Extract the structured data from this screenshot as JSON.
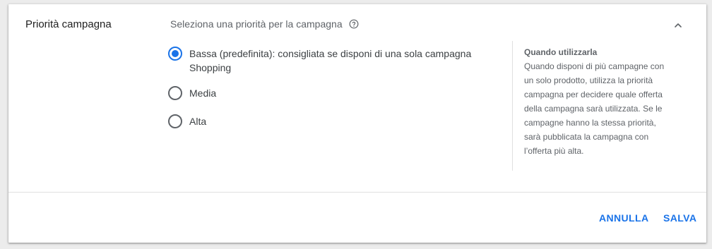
{
  "section": {
    "title": "Priorità campagna",
    "subtitle": "Seleziona una priorità per la campagna"
  },
  "icons": {
    "help": "help-circle-icon",
    "collapse": "chevron-up-icon"
  },
  "options": [
    {
      "label": "Bassa (predefinita): consigliata se disponi di una sola campagna Shopping",
      "selected": true
    },
    {
      "label": "Media",
      "selected": false
    },
    {
      "label": "Alta",
      "selected": false
    }
  ],
  "help_panel": {
    "title": "Quando utilizzarla",
    "body": "Quando disponi di più campagne con un solo prodotto, utilizza la priorità campagna per decidere quale offerta della campagna sarà utilizzata. Se le campagne hanno la stessa priorità, sarà pubblicata la campagna con l’offerta più alta."
  },
  "actions": {
    "cancel": "ANNULLA",
    "save": "SALVA"
  },
  "colors": {
    "accent": "#1a73e8",
    "text_primary": "#212121",
    "text_secondary": "#5f6368"
  }
}
